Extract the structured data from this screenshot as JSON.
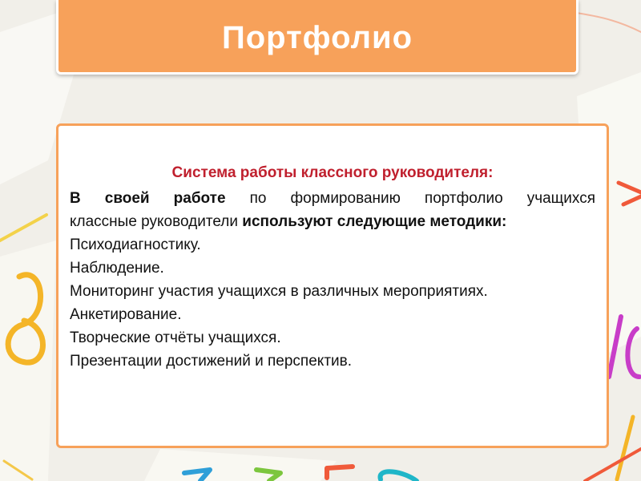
{
  "slide": {
    "title": "Портфолио",
    "subtitle": "Система работы классного руководителя:",
    "intro": {
      "bold_1": "В своей работе",
      "text_1": " по формированию портфолио учащихся",
      "text_2": "классные руководители ",
      "bold_2": "используют следующие методики:"
    },
    "methods": [
      "Психодиагностику.",
      "Наблюдение.",
      "Мониторинг участия учащихся в различных мероприятиях.",
      "Анкетирование.",
      "Творческие отчёты учащихся.",
      "Презентации достижений и перспектив."
    ]
  },
  "background": {
    "digits": [
      "8",
      "1",
      "0",
      "7",
      "3",
      "5",
      "8"
    ],
    "colors": [
      "#f4b528",
      "#c83dc8",
      "#f05a3a",
      "#2f9fd8",
      "#7cc63e",
      "#1fb6c8"
    ]
  },
  "colors": {
    "accent": "#f7a15a",
    "subtitle": "#c0202e"
  }
}
